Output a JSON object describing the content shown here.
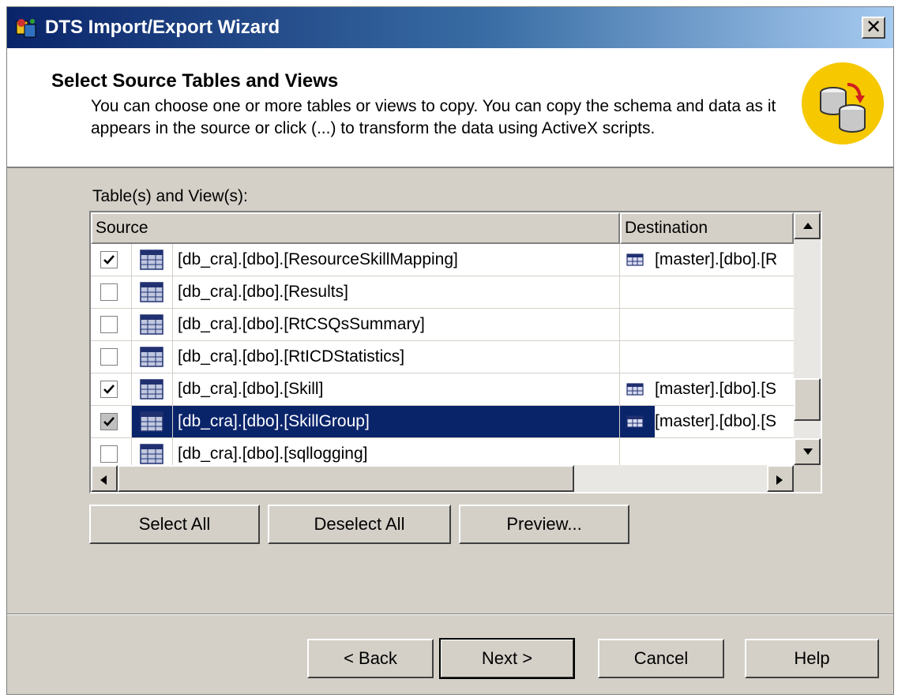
{
  "window": {
    "title": "DTS Import/Export Wizard",
    "close_label": "✕"
  },
  "header": {
    "title": "Select Source Tables and Views",
    "description": "You can choose one or more tables or views to copy.  You can copy the schema and data as it appears in the source or click (...) to transform the data using ActiveX scripts."
  },
  "list": {
    "label": "Table(s) and View(s):",
    "columns": {
      "source": "Source",
      "destination": "Destination"
    },
    "rows": [
      {
        "checked": true,
        "source": "[db_cra].[dbo].[ResourceSkillMapping]",
        "destination": "[master].[dbo].[R",
        "selected": false
      },
      {
        "checked": false,
        "source": "[db_cra].[dbo].[Results]",
        "destination": "",
        "selected": false
      },
      {
        "checked": false,
        "source": "[db_cra].[dbo].[RtCSQsSummary]",
        "destination": "",
        "selected": false
      },
      {
        "checked": false,
        "source": "[db_cra].[dbo].[RtICDStatistics]",
        "destination": "",
        "selected": false
      },
      {
        "checked": true,
        "source": "[db_cra].[dbo].[Skill]",
        "destination": "[master].[dbo].[S",
        "selected": false
      },
      {
        "checked": true,
        "source": "[db_cra].[dbo].[SkillGroup]",
        "destination": "[master].[dbo].[S",
        "selected": true
      },
      {
        "checked": false,
        "source": "[db_cra].[dbo].[sqllogging]",
        "destination": "",
        "selected": false
      }
    ]
  },
  "list_buttons": {
    "select_all": "Select All",
    "deselect_all": "Deselect All",
    "preview": "Preview..."
  },
  "footer": {
    "back": "< Back",
    "next": "Next >",
    "cancel": "Cancel",
    "help": "Help"
  },
  "colors": {
    "title_bar": "#0a246a",
    "selection": "#0a246a",
    "dialog_face": "#d4d0c8"
  }
}
